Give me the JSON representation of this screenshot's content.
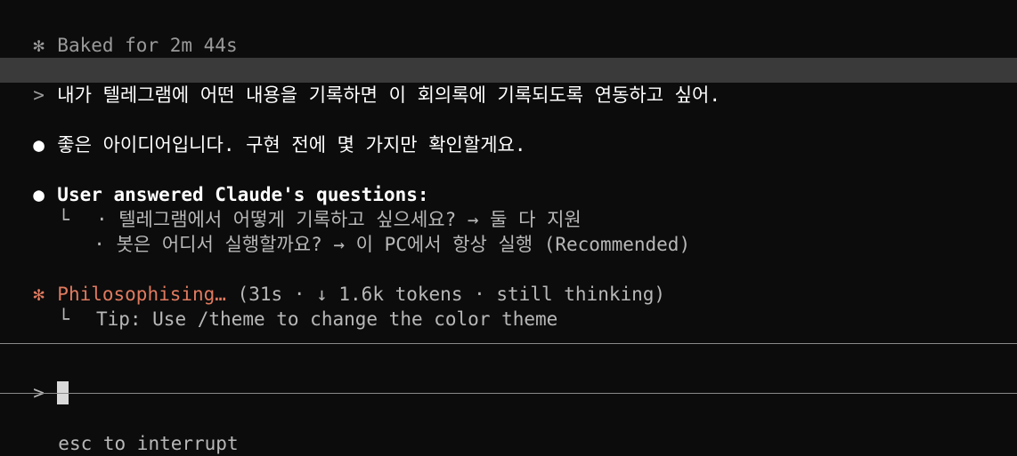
{
  "header": {
    "glyph": "✻",
    "status": "Baked for 2m 44s"
  },
  "user_message": {
    "prompt": ">",
    "text": "내가 텔레그램에 어떤 내용을 기록하면 이 회의록에 기록되도록 연동하고 싶어."
  },
  "assistant_message": {
    "bullet": "●",
    "text": "좋은 아이디어입니다. 구현 전에 몇 가지만 확인할게요."
  },
  "answers": {
    "bullet": "●",
    "title": "User answered Claude's questions:",
    "branch": "└",
    "items": [
      "· 텔레그램에서 어떻게 기록하고 싶으세요? → 둘 다 지원",
      "· 봇은 어디서 실행할까요? → 이 PC에서 항상 실행 (Recommended)"
    ]
  },
  "thinking": {
    "glyph": "✻",
    "label": "Philosophising…",
    "meta": "(31s · ↓ 1.6k tokens · still thinking)",
    "branch": "└",
    "tip": "Tip: Use /theme to change the color theme"
  },
  "input": {
    "prompt": ">",
    "value": ""
  },
  "footer": {
    "hint": "esc to interrupt"
  },
  "colors": {
    "background": "#0c0c0c",
    "accent": "#e07a5f",
    "user_highlight": "#3a3a3a"
  }
}
